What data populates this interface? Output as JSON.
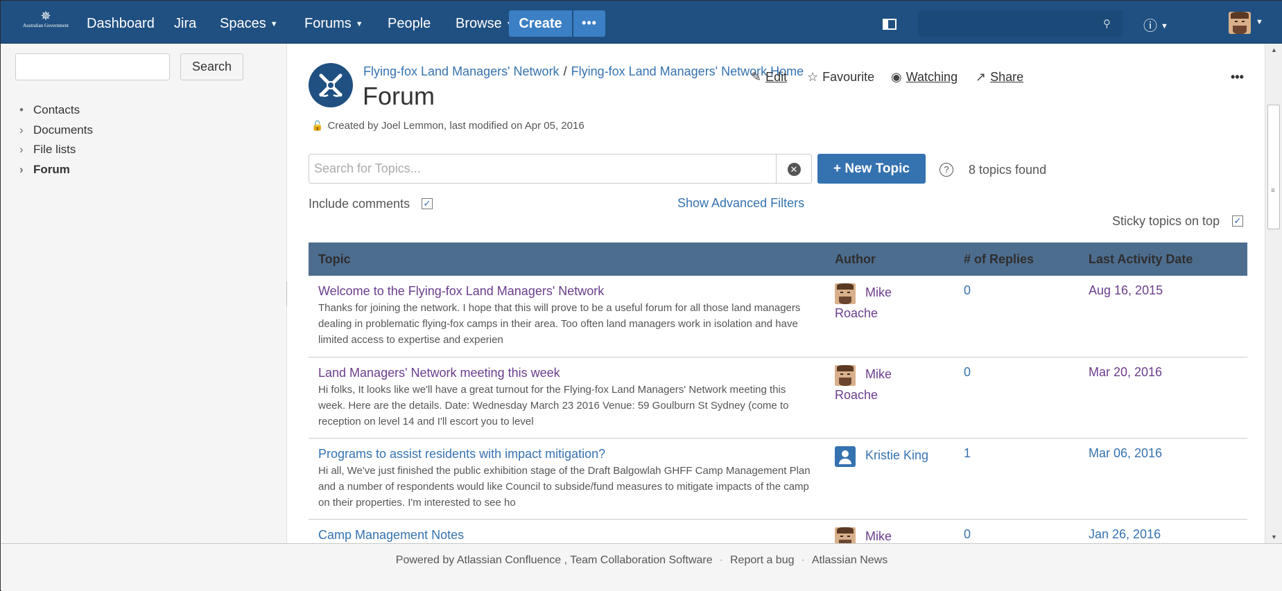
{
  "nav": {
    "logo_text": "Australian Government",
    "links": [
      {
        "label": "Dashboard"
      },
      {
        "label": "Jira"
      },
      {
        "label": "Spaces"
      },
      {
        "label": "Forums"
      },
      {
        "label": "People"
      },
      {
        "label": "Browse"
      }
    ],
    "create_label": "Create",
    "more_label": "•••"
  },
  "sidebar": {
    "search_button": "Search",
    "items": [
      {
        "marker": "•",
        "label": "Contacts"
      },
      {
        "marker": "›",
        "label": "Documents"
      },
      {
        "marker": "›",
        "label": "File lists"
      },
      {
        "marker": "›",
        "label": "Forum"
      }
    ]
  },
  "page": {
    "breadcrumbs": [
      "Flying-fox Land Managers' Network",
      "Flying-fox Land Managers' Network Home"
    ],
    "breadcrumb_sep": "/",
    "title": "Forum",
    "byline": "Created by Joel Lemmon, last modified on Apr 05, 2016",
    "actions": {
      "edit": "Edit",
      "favourite": "Favourite",
      "watching": "Watching",
      "share": "Share",
      "more": "•••"
    }
  },
  "forum": {
    "search_placeholder": "Search for Topics...",
    "new_topic": "+ New Topic",
    "topics_found": "8 topics found",
    "include_comments": "Include comments",
    "include_comments_checked": true,
    "advanced_filters": "Show Advanced Filters",
    "sticky_topics": "Sticky topics on top",
    "sticky_checked": true,
    "columns": [
      "Topic",
      "Author",
      "# of Replies",
      "Last Activity Date"
    ],
    "rows": [
      {
        "title": "Welcome to the Flying-fox Land Managers' Network",
        "excerpt": "Thanks for joining the network. I hope that this will prove to be a useful forum for all those land managers dealing in problematic flying-fox camps in their area. Too often land managers work in isolation and have limited access to expertise and experien",
        "author_first": "Mike",
        "author_last": "Roache",
        "replies": "0",
        "date": "Aug 16, 2015"
      },
      {
        "title": "Land Managers' Network meeting this week",
        "excerpt": "Hi folks, It looks like we'll have a great turnout for the Flying-fox Land Managers' Network meeting  this week. Here are the details.   Date: Wednesday March 23 2016 Venue: 59 Goulburn St Sydney (come to reception on level 14 and I'll escort you to level",
        "author_first": "Mike",
        "author_last": "Roache",
        "replies": "0",
        "date": "Mar 20, 2016"
      },
      {
        "title": "Programs to assist residents with impact mitigation?",
        "excerpt": "Hi all, We've just finished the public exhibition stage of the Draft Balgowlah GHFF Camp Management Plan and a number of respondents would like Council to subside/fund measures to mitigate impacts of the camp on their properties.  I'm interested to see ho",
        "author_first": "Kristie King",
        "author_last": "",
        "replies": "1",
        "date": "Mar 06, 2016"
      },
      {
        "title": "Camp Management Notes",
        "excerpt": "",
        "author_first": "Mike",
        "author_last": "",
        "replies": "0",
        "date": "Jan 26, 2016"
      }
    ]
  },
  "footer": {
    "powered": "Powered by Atlassian Confluence , Team Collaboration Software",
    "report": "Report a bug",
    "news": "Atlassian News",
    "sep": "·"
  },
  "colors": {
    "nav_bg": "#205081",
    "accent": "#3572b0",
    "visited": "#6b3d8c",
    "table_header": "#4d6d8f"
  }
}
